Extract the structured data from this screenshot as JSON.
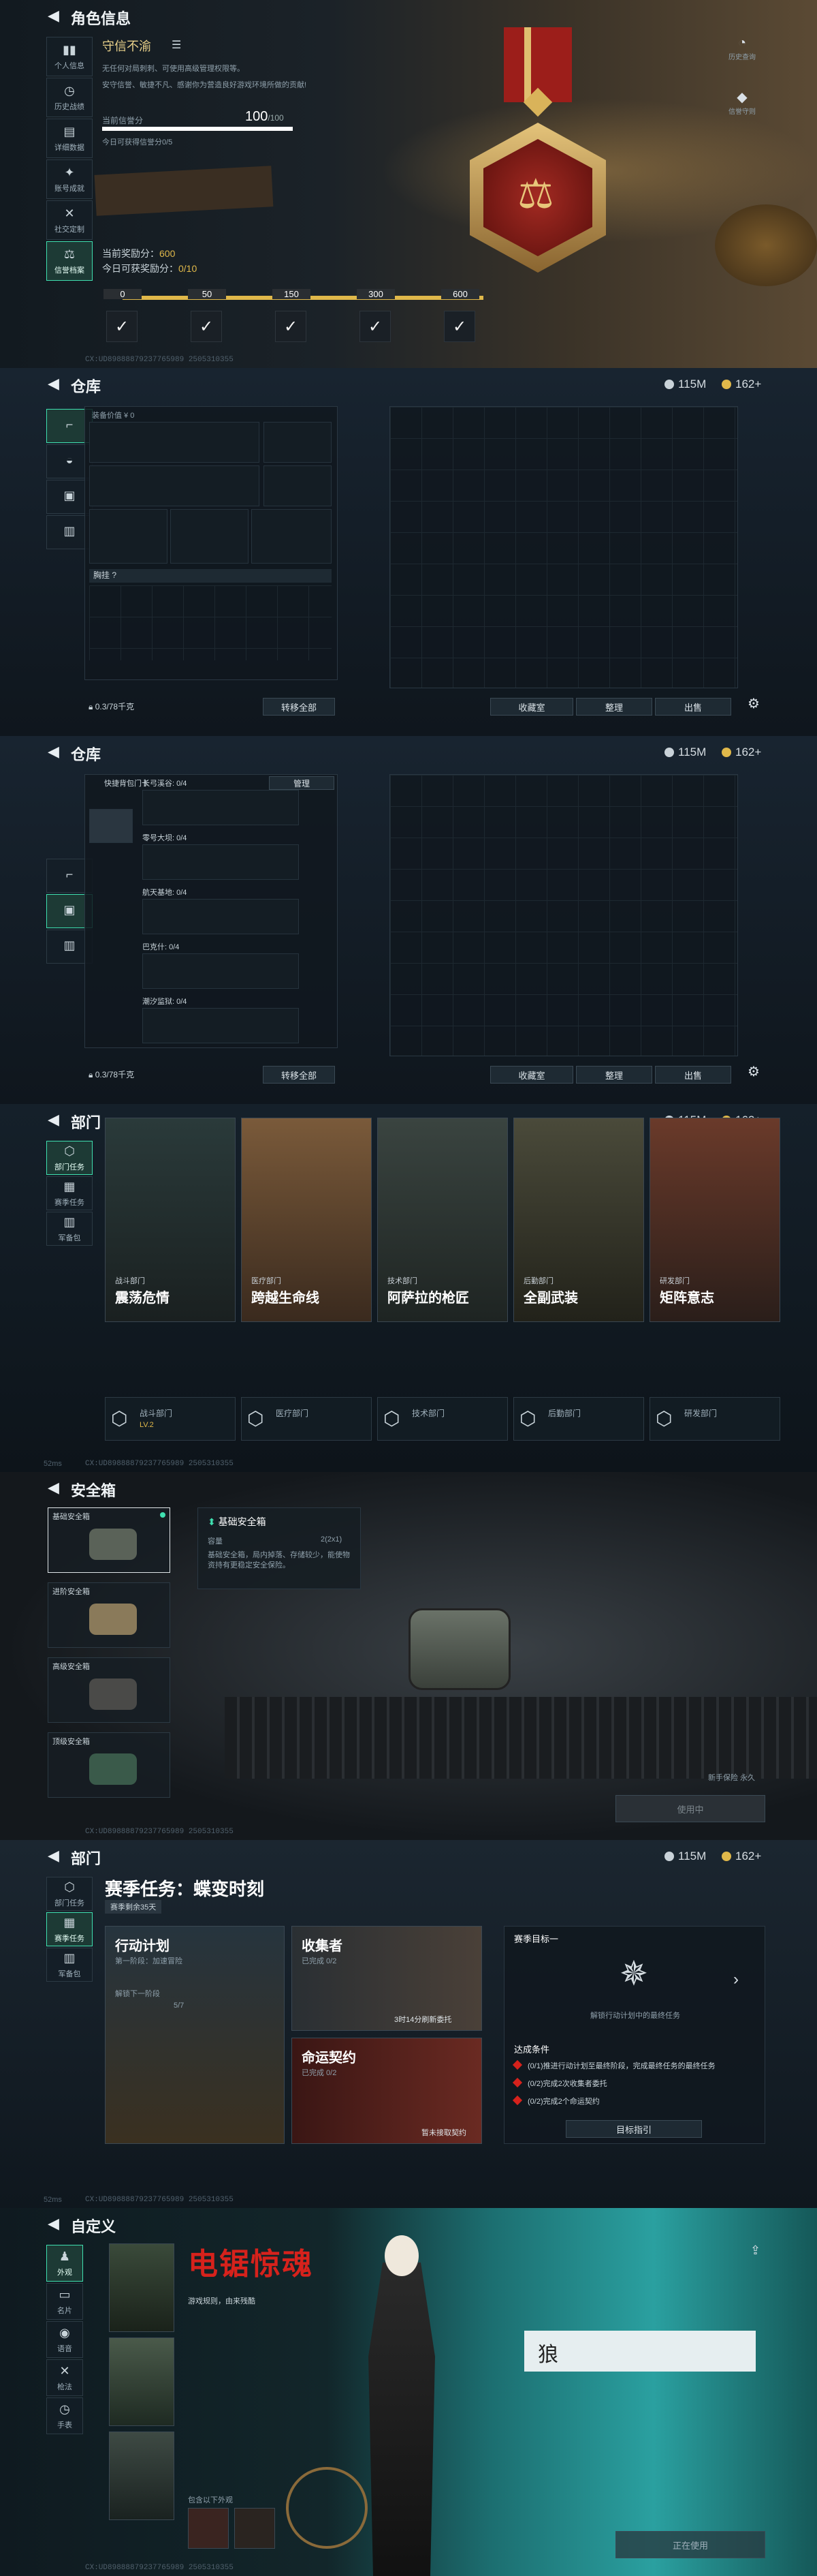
{
  "profile": {
    "title": "角色信息",
    "side": [
      "个人信息",
      "历史战绩",
      "详细数据",
      "账号成就",
      "社交定制",
      "信誉档案"
    ],
    "name": "守信不渝",
    "desc1": "无任何对局刺刺、可使用高级管理权限等。",
    "desc2": "安守信誉、敏捷不凡、感谢你为营造良好游戏环境所做的贡献!",
    "score_label": "当前信誉分",
    "score": "100",
    "score_max": "/100",
    "weekly": "今日可获得信誉分0/5",
    "reward_label": "当前奖励分：",
    "reward": "600",
    "daily_label": "今日可获奖励分：",
    "daily": "0/10",
    "milestones": [
      "0",
      "50",
      "150",
      "300",
      "600"
    ],
    "right_btns": [
      "历史查询",
      "信誉守则"
    ],
    "progress": 1.0
  },
  "warehouse": {
    "title": "仓库",
    "money": "115M",
    "coins": "162+",
    "value_label": "装备价值 ¥ 0",
    "chest": "胸挂",
    "capacity": "0.3/78千克",
    "transfer": "转移全部",
    "buttons": [
      "收藏室",
      "整理",
      "出售"
    ],
    "pocket": "快捷背包门卡",
    "manage": "管理",
    "keys": [
      "长弓溪谷: 0/4",
      "零号大坝: 0/4",
      "航天基地: 0/4",
      "巴克什: 0/4",
      "潮汐监狱: 0/4"
    ]
  },
  "dept": {
    "title": "部门",
    "side": [
      "部门任务",
      "赛季任务",
      "军备包"
    ],
    "cards": [
      {
        "cat": "战斗部门",
        "name": "震荡危情"
      },
      {
        "cat": "医疗部门",
        "name": "跨越生命线"
      },
      {
        "cat": "技术部门",
        "name": "阿萨拉的枪匠"
      },
      {
        "cat": "后勤部门",
        "name": "全副武装"
      },
      {
        "cat": "研发部门",
        "name": "矩阵意志"
      }
    ],
    "bottom": [
      {
        "name": "战斗部门",
        "lv": "LV.2"
      },
      {
        "name": "医疗部门",
        "lv": ""
      },
      {
        "name": "技术部门",
        "lv": ""
      },
      {
        "name": "后勤部门",
        "lv": ""
      },
      {
        "name": "研发部门",
        "lv": ""
      }
    ]
  },
  "safe": {
    "title": "安全箱",
    "items": [
      "基础安全箱",
      "进阶安全箱",
      "高级安全箱",
      "顶级安全箱"
    ],
    "detail_name": "基础安全箱",
    "capacity_label": "容量",
    "capacity": "2(2x1)",
    "detail_desc": "基础安全箱，局内掉落、存储较少，能使物资持有更稳定安全保险。",
    "rent": "新手保险 永久",
    "btn": "使用中"
  },
  "season": {
    "title": "部门",
    "heading": "赛季任务：蝶变时刻",
    "sub": "赛季剩余35天",
    "action": "行动计划",
    "stage": "第一阶段：加速冒险",
    "unlock": "解锁下一阶段",
    "goal1": "5/7",
    "collector": "收集者",
    "done1": "已完成 0/2",
    "timer": "3时14分刷新委托",
    "contract": "命运契约",
    "done2": "已完成 0/2",
    "accept": "暂未接取契约",
    "target": "赛季目标一",
    "mission": "解锁行动计划中的最终任务",
    "cond": "达成条件",
    "conds": [
      "(0/1)推进行动计划至最终阶段，完成最终任务的最终任务",
      "(0/2)完成2次收集者委托",
      "(0/2)完成2个命运契约"
    ],
    "guide": "目标指引"
  },
  "custom": {
    "title": "自定义",
    "side": [
      "外观",
      "名片",
      "语音",
      "枪法",
      "手表"
    ],
    "logo": "电锯惊魂",
    "sub": "游戏规则，由来残酷",
    "tag": "狼",
    "stock": "包含以下外观",
    "btn": "正在使用"
  },
  "footer": {
    "id": "CX:UD89888879237765989 2505310355",
    "ms": "52ms"
  },
  "colors": {
    "accent": "#3fe0b0",
    "gold": "#e0b84a",
    "red": "#b0251f"
  }
}
